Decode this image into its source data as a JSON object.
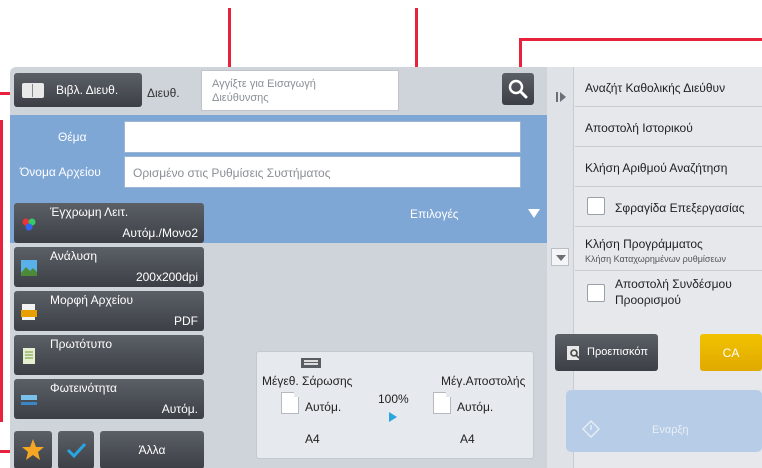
{
  "header": {
    "address_book_label": "Βιβλ. Διευθ.",
    "destination_label": "Διευθ.",
    "destination_placeholder_line1": "Αγγίξτε για Εισαγωγή",
    "destination_placeholder_line2": "Διεύθυνσης"
  },
  "fields": {
    "subject_label": "Θέμα",
    "filename_label": "Όνομα Αρχείου",
    "filename_placeholder": "Ορισμένο στις Ρυθμίσεις Συστήματος",
    "options_label": "Επιλογές"
  },
  "functions": [
    {
      "title": "Έγχρωμη Λειτ.",
      "value": "Αυτόμ./Μονο2"
    },
    {
      "title": "Ανάλυση",
      "value": "200x200dpi"
    },
    {
      "title": "Μορφή Αρχείου",
      "value": "PDF"
    },
    {
      "title": "Πρωτότυπο",
      "value": ""
    },
    {
      "title": "Φωτεινότητα",
      "value": "Αυτόμ."
    }
  ],
  "bottom": {
    "other_label": "Άλλα"
  },
  "scan": {
    "scan_size_label": "Μέγεθ. Σάρωσης",
    "send_size_label": "Μέγ.Αποστολής",
    "ratio": "100%",
    "scan_auto": "Αυτόμ.",
    "send_auto": "Αυτόμ.",
    "scan_paper": "A4",
    "send_paper": "A4"
  },
  "actions": [
    {
      "label": "Αναζήτ Καθολικής Διεύθυν"
    },
    {
      "label": "Αποστολή Ιστορικού"
    },
    {
      "label": "Κλήση Αριθμού Αναζήτηση"
    },
    {
      "label": "Σφραγίδα Επεξεργασίας"
    },
    {
      "label": "Κλήση Προγράμματος",
      "sub": "Κλήση Καταχωρημένων ρυθμίσεων"
    },
    {
      "label_line1": "Αποστολή Συνδέσμου",
      "label_line2": "Προορισμού"
    }
  ],
  "preview_label": "Προεπισκόπ",
  "ca_label": "CA",
  "start_label": "Εναρξη",
  "colors": {
    "panel_bg": "#cfd4db",
    "blue_area": "#7fa7d6",
    "dark_button": "#3c4046",
    "ca_yellow": "#f2c200",
    "start_disabled": "#b7cce6",
    "callout_red": "#e8223c",
    "favorite_star": "#f5a623",
    "check_blue": "#29a6e0"
  },
  "icons": [
    "address-book-icon",
    "search-icon",
    "expand-options-icon",
    "favorite-star-icon",
    "checkmark-icon",
    "scroll-down-icon",
    "collapse-panel-icon",
    "preview-icon",
    "start-icon",
    "scanner-icon"
  ]
}
